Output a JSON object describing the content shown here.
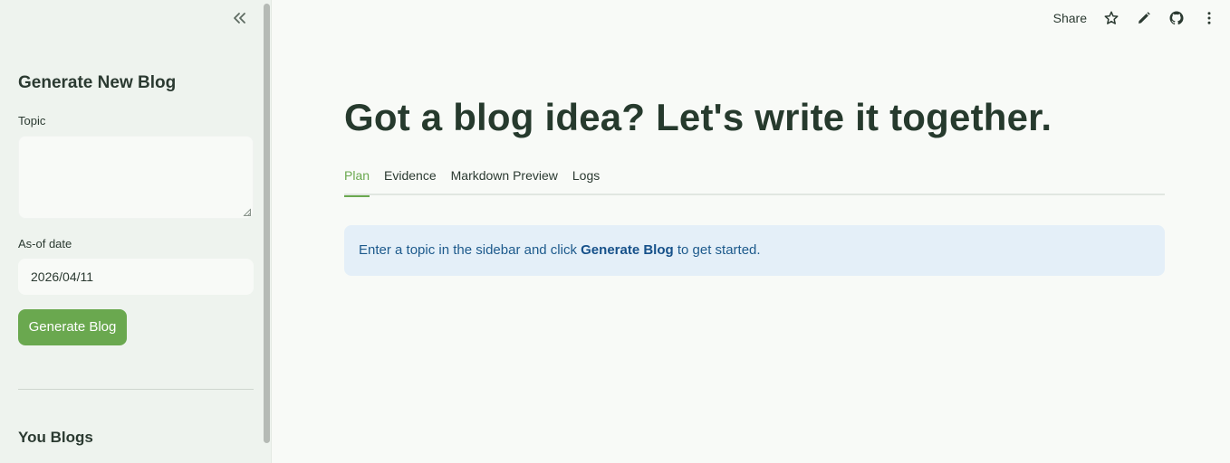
{
  "sidebar": {
    "collapse_icon": "chevrons-left-icon",
    "heading": "Generate New Blog",
    "topic_label": "Topic",
    "topic_value": "",
    "date_label": "As-of date",
    "date_value": "2026/04/11",
    "generate_button": "Generate Blog",
    "blogs_heading": "You Blogs"
  },
  "toolbar": {
    "share_label": "Share",
    "icons": [
      "star-icon",
      "pencil-icon",
      "github-icon",
      "more-vertical-icon"
    ]
  },
  "main": {
    "title": "Got a blog idea? Let's write it together.",
    "tabs": [
      {
        "label": "Plan",
        "active": true
      },
      {
        "label": "Evidence"
      },
      {
        "label": "Markdown Preview"
      },
      {
        "label": "Logs"
      }
    ],
    "info": {
      "before": "Enter a topic in the sidebar and click ",
      "bold": "Generate Blog",
      "after": " to get started."
    }
  },
  "colors": {
    "accent": "#6aa84f",
    "sidebar_bg": "#eef3ee",
    "info_bg": "#e4eff8",
    "info_text": "#1d5a8c"
  }
}
